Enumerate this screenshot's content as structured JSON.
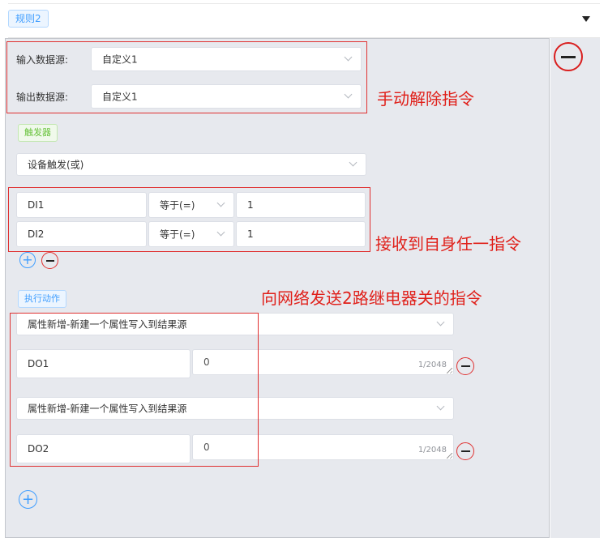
{
  "rule_tag": "规则2",
  "source": {
    "input_label": "输入数据源:",
    "input_value": "自定义1",
    "output_label": "输出数据源:",
    "output_value": "自定义1"
  },
  "trigger": {
    "tag": "触发器",
    "mode": "设备触发(或)",
    "conditions": [
      {
        "name": "DI1",
        "op": "等于(=)",
        "value": "1"
      },
      {
        "name": "DI2",
        "op": "等于(=)",
        "value": "1"
      }
    ]
  },
  "action": {
    "tag": "执行动作",
    "items": [
      {
        "type": "属性新增-新建一个属性写入到结果源",
        "name": "DO1",
        "value": "0",
        "count": "1/2048"
      },
      {
        "type": "属性新增-新建一个属性写入到结果源",
        "name": "DO2",
        "value": "0",
        "count": "1/2048"
      }
    ]
  },
  "annotations": {
    "release": "手动解除指令",
    "receive": "接收到自身任一指令",
    "send": "向网络发送2路继电器关的指令"
  },
  "colors": {
    "primary": "#409eff",
    "danger": "#e03030",
    "success": "#67c23a"
  },
  "icons": {
    "add": "plus-circle-icon",
    "remove": "minus-circle-icon",
    "collapse": "caret-down-icon"
  }
}
